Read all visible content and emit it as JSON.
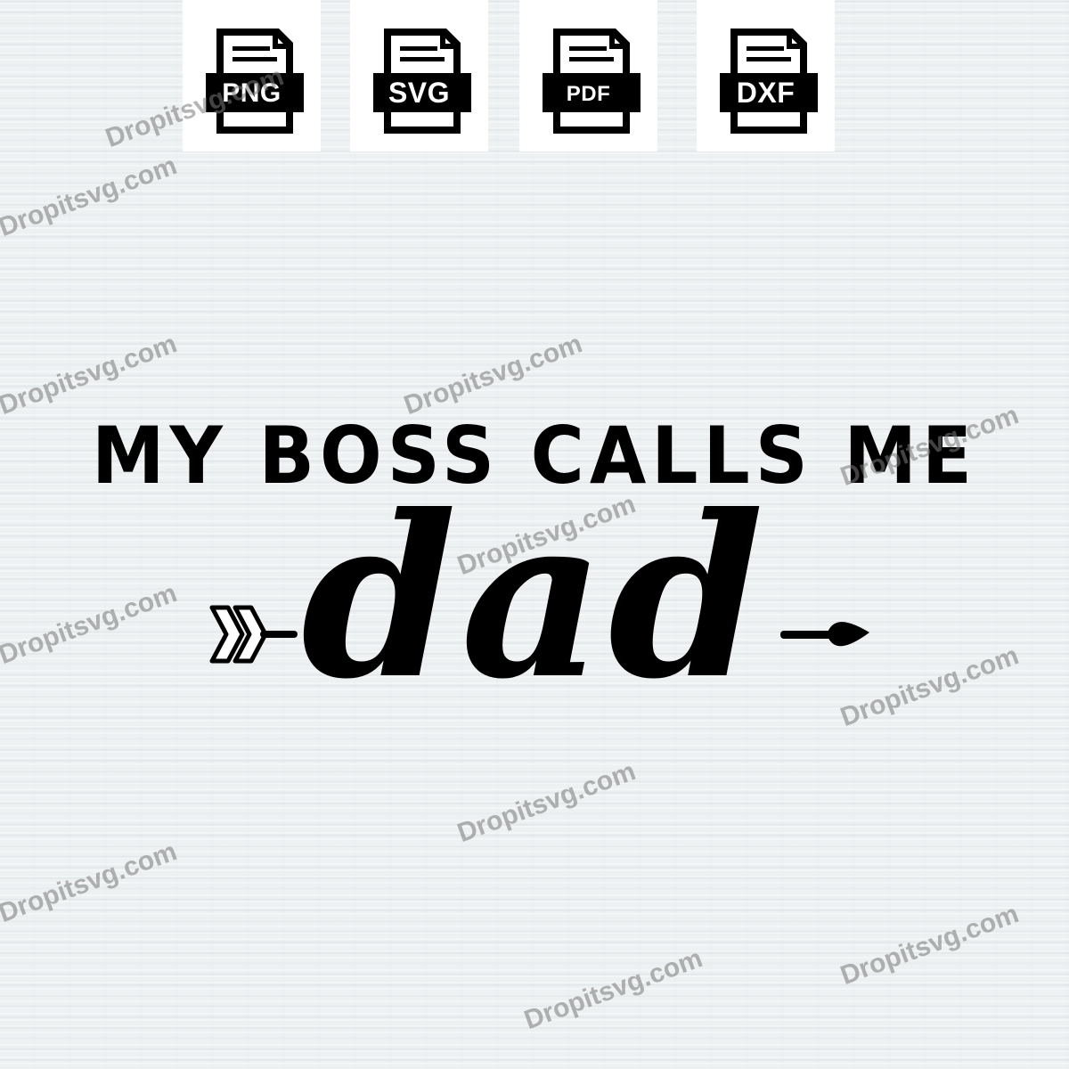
{
  "formats": [
    {
      "label": "PNG",
      "icon": "file-icon"
    },
    {
      "label": "SVG",
      "icon": "file-icon"
    },
    {
      "label": "PDF",
      "icon": "file-icon"
    },
    {
      "label": "DXF",
      "icon": "file-icon"
    }
  ],
  "design": {
    "headline": "MY BOSS CALLS ME",
    "main_word": "dad",
    "left_ornament": "arrow-tail-icon",
    "right_ornament": "arrow-head-icon"
  },
  "watermark": "Dropitsvg.com",
  "colors": {
    "background": "#eef1f2",
    "ink": "#000000",
    "card": "#ffffff",
    "watermark": "#787878"
  }
}
